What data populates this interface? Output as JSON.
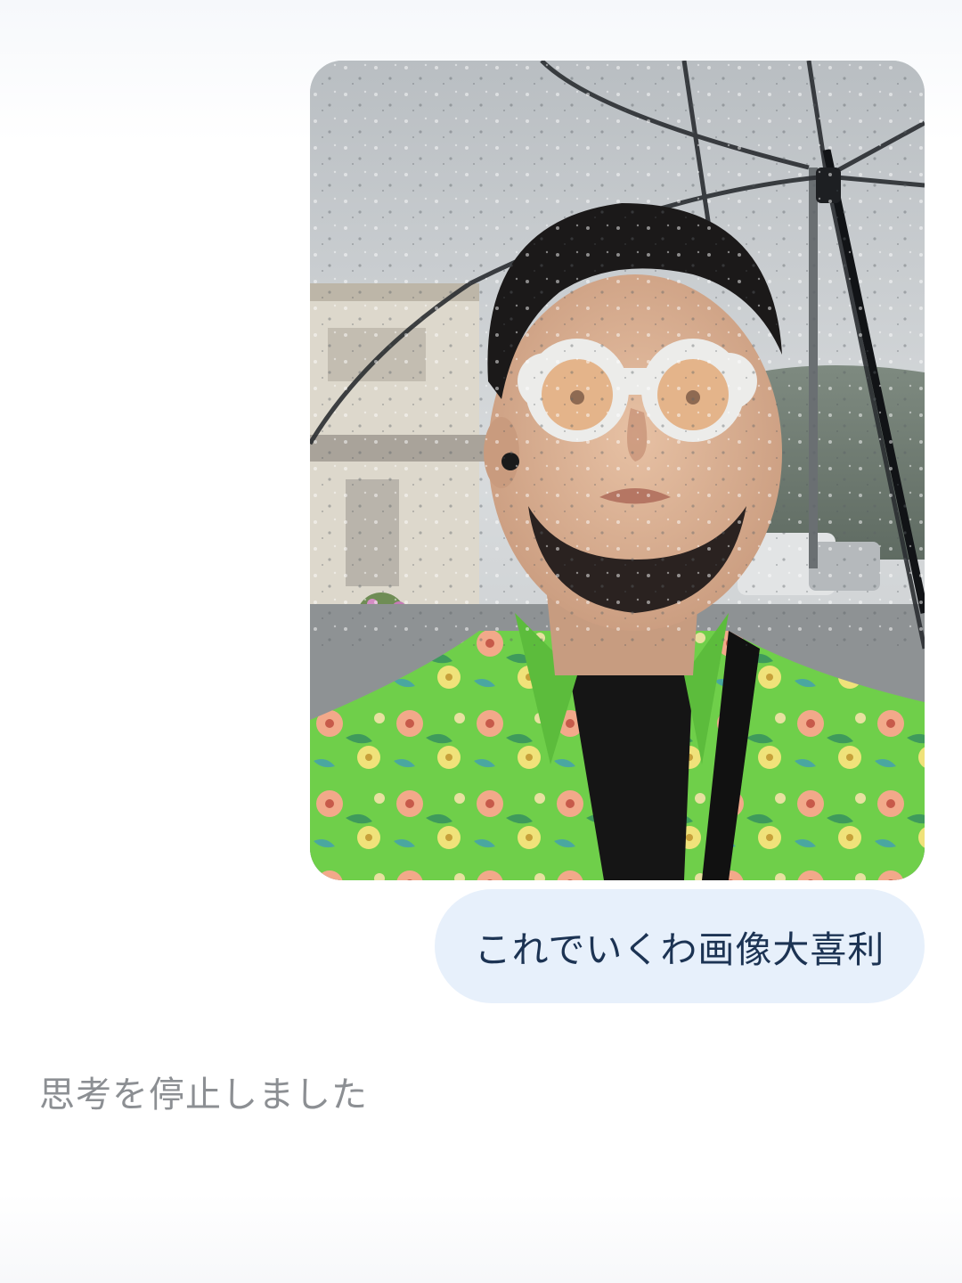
{
  "conversation": {
    "user_message": {
      "attachment": {
        "kind": "photo",
        "icon": "selfie-photo"
      },
      "text": "これでいくわ画像大喜利"
    },
    "assistant_status": "思考を停止しました"
  },
  "colors": {
    "bubble_background": "#e7f0fb",
    "bubble_text": "#1c3353",
    "status_text": "#8c8f93",
    "shirt_green": "#6fcf4a",
    "sky_grey": "#c9cdd0"
  }
}
